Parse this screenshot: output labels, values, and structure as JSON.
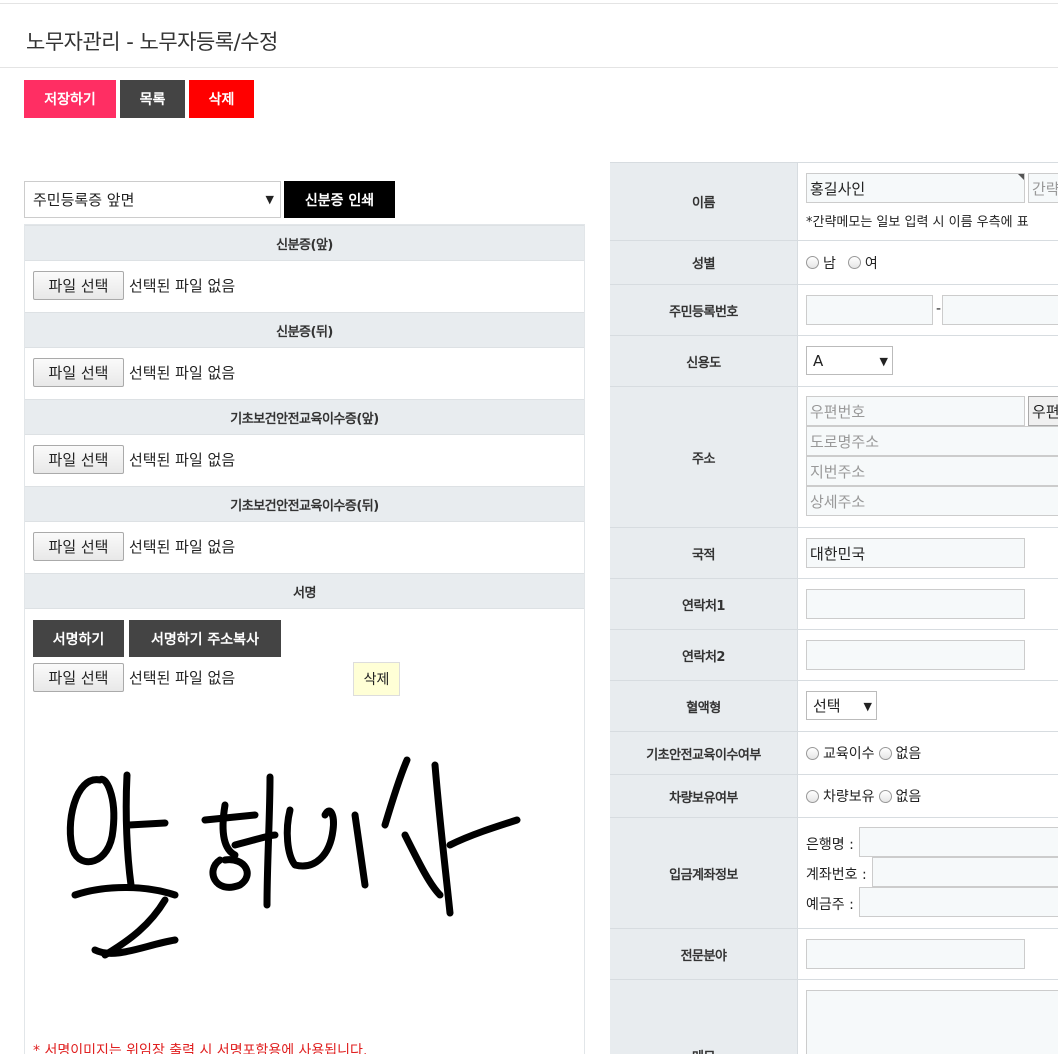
{
  "page": {
    "title": "노무자관리 - 노무자등록/수정"
  },
  "toolbar": {
    "save_label": "저장하기",
    "list_label": "목록",
    "delete_label": "삭제"
  },
  "left": {
    "doc_select_value": "주민등록증 앞면",
    "print_label": "신분증 인쇄",
    "file_button": "파일 선택",
    "no_file": "선택된 파일 없음",
    "sections": [
      {
        "title": "신분증(앞)"
      },
      {
        "title": "신분증(뒤)"
      },
      {
        "title": "기초보건안전교육이수증(앞)"
      },
      {
        "title": "기초보건안전교육이수증(뒤)"
      },
      {
        "title": "서명"
      }
    ],
    "sign_button": "서명하기",
    "sign_copy_button": "서명하기 주소복사",
    "sign_delete": "삭제",
    "sign_note": "* 서명이미지는 위임장 출력 시 서명포함용에 사용됩니다."
  },
  "form": {
    "name": {
      "label": "이름",
      "value": "홍길사인",
      "memo_placeholder": "간략",
      "note": "*간략메모는 일보 입력 시 이름 우측에 표"
    },
    "gender": {
      "label": "성별",
      "options": [
        "남",
        "여"
      ]
    },
    "rrn": {
      "label": "주민등록번호",
      "separator": "-"
    },
    "credit": {
      "label": "신용도",
      "value": "A"
    },
    "address": {
      "label": "주소",
      "zip_placeholder": "우편번호",
      "zip_button": "우편",
      "road_placeholder": "도로명주소",
      "jibun_placeholder": "지번주소",
      "detail_placeholder": "상세주소"
    },
    "nationality": {
      "label": "국적",
      "value": "대한민국"
    },
    "contact1": {
      "label": "연락처1"
    },
    "contact2": {
      "label": "연락처2"
    },
    "blood": {
      "label": "혈액형",
      "value": "선택"
    },
    "education": {
      "label": "기초안전교육이수여부",
      "options": [
        "교육이수",
        "없음"
      ]
    },
    "vehicle": {
      "label": "차량보유여부",
      "options": [
        "차량보유",
        "없음"
      ]
    },
    "bank": {
      "label": "입금계좌정보",
      "bank_name": "은행명 :",
      "account_no": "계좌번호 :",
      "holder": "예금주 :"
    },
    "specialty": {
      "label": "전문분야"
    },
    "memo": {
      "label": "메모"
    }
  }
}
